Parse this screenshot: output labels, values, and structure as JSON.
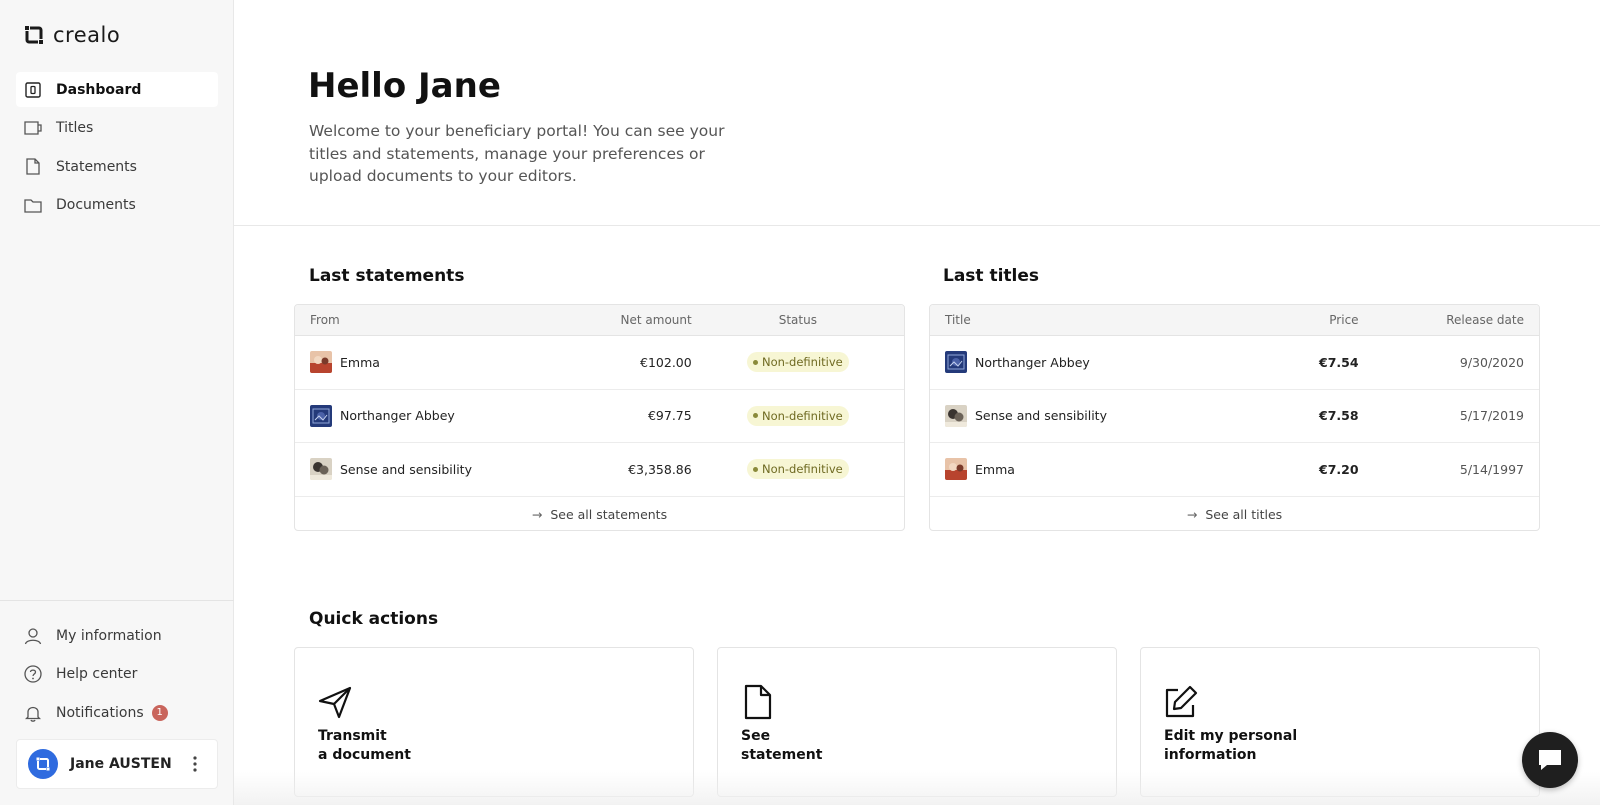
{
  "app": {
    "logo_text": "crealo"
  },
  "sidebar": {
    "items": [
      {
        "label": "Dashboard",
        "icon": "dashboard-icon",
        "active": true
      },
      {
        "label": "Titles",
        "icon": "titles-icon"
      },
      {
        "label": "Statements",
        "icon": "file-icon"
      },
      {
        "label": "Documents",
        "icon": "folder-icon"
      }
    ],
    "bottom_items": [
      {
        "label": "My information",
        "icon": "user-icon"
      },
      {
        "label": "Help center",
        "icon": "help-icon"
      },
      {
        "label": "Notifications",
        "icon": "bell-icon",
        "badge": "1"
      }
    ],
    "user": {
      "name": "Jane AUSTEN"
    }
  },
  "hero": {
    "greeting": "Hello Jane",
    "welcome": "Welcome to your beneficiary portal! You can see your titles and statements, manage your preferences or upload documents to your editors."
  },
  "statements": {
    "title": "Last statements",
    "columns": {
      "from": "From",
      "net_amount": "Net amount",
      "status": "Status"
    },
    "rows": [
      {
        "from": "Emma",
        "amount": "€102.00",
        "status": "Non-definitive"
      },
      {
        "from": "Northanger Abbey",
        "amount": "€97.75",
        "status": "Non-definitive"
      },
      {
        "from": "Sense and sensibility",
        "amount": "€3,358.86",
        "status": "Non-definitive"
      }
    ],
    "see_all": "See all statements"
  },
  "titles": {
    "title": "Last titles",
    "columns": {
      "title": "Title",
      "price": "Price",
      "release_date": "Release date"
    },
    "rows": [
      {
        "title": "Northanger Abbey",
        "price": "€7.54",
        "release_date": "9/30/2020"
      },
      {
        "title": "Sense and sensibility",
        "price": "€7.58",
        "release_date": "5/17/2019"
      },
      {
        "title": "Emma",
        "price": "€7.20",
        "release_date": "5/14/1997"
      }
    ],
    "see_all": "See all titles"
  },
  "quick_actions": {
    "title": "Quick actions",
    "items": [
      {
        "line1": "Transmit",
        "line2": "a document",
        "icon": "send-icon"
      },
      {
        "line1": "See",
        "line2": "statement",
        "icon": "file-icon"
      },
      {
        "line1": "Edit my personal",
        "line2": "information",
        "icon": "edit-icon"
      }
    ]
  },
  "colors": {
    "accent_blue": "#2f6bdf",
    "badge_red": "#c9655c",
    "status_bg": "#f7f6d4",
    "chat_bg": "#1f1f1f"
  }
}
